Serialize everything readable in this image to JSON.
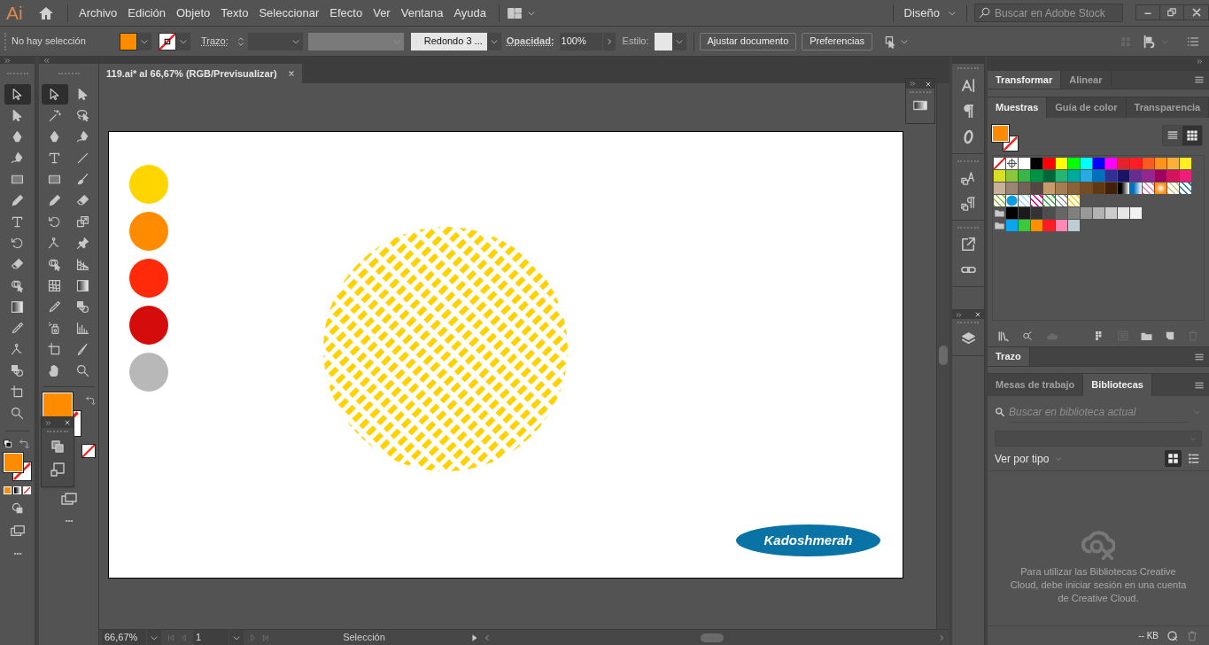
{
  "app": {
    "logo": "Ai"
  },
  "menu": [
    {
      "label": "Archivo"
    },
    {
      "label": "Edición"
    },
    {
      "label": "Objeto"
    },
    {
      "label": "Texto"
    },
    {
      "label": "Seleccionar"
    },
    {
      "label": "Efecto"
    },
    {
      "label": "Ver"
    },
    {
      "label": "Ventana"
    },
    {
      "label": "Ayuda"
    }
  ],
  "workspace": {
    "label": "Diseño"
  },
  "stock_search": {
    "placeholder": "Buscar en Adobe Stock"
  },
  "control_bar": {
    "selection": "No hay selección",
    "stroke_label": "Trazo:",
    "brush": "Redondo 3 ...",
    "opacity_label": "Opacidad:",
    "opacity": "100%",
    "style_label": "Estilo:",
    "buttons": [
      "Ajustar documento",
      "Preferencias"
    ]
  },
  "document_tab": {
    "title": "119.ai* al 66,67% (RGB/Previsualizar)"
  },
  "toolbar_left": [
    {
      "kind": "select",
      "selected": true
    },
    {
      "kind": "direct",
      "selected": false
    },
    {
      "kind": "pen",
      "selected": false
    },
    {
      "kind": "curve",
      "selected": false
    },
    {
      "kind": "rect",
      "selected": false
    },
    {
      "kind": "pencil",
      "selected": false
    },
    {
      "kind": "type",
      "selected": false
    },
    {
      "kind": "rotate",
      "selected": false
    },
    {
      "kind": "eraser",
      "selected": false
    },
    {
      "kind": "shapebuilder",
      "selected": false
    },
    {
      "kind": "gradient",
      "selected": false
    },
    {
      "kind": "eyedropper",
      "selected": false
    },
    {
      "kind": "warp",
      "selected": false
    },
    {
      "kind": "blend",
      "selected": false
    },
    {
      "kind": "artboard",
      "selected": false
    },
    {
      "kind": "zoom",
      "selected": false
    }
  ],
  "toolbar_right": [
    {
      "kind": "select",
      "selected": true
    },
    {
      "kind": "direct",
      "selected": false
    },
    {
      "kind": "wand",
      "selected": false
    },
    {
      "kind": "lasso",
      "selected": false
    },
    {
      "kind": "pen",
      "selected": false
    },
    {
      "kind": "curve",
      "selected": false
    },
    {
      "kind": "type",
      "selected": false
    },
    {
      "kind": "line",
      "selected": false
    },
    {
      "kind": "rect",
      "selected": false
    },
    {
      "kind": "brush",
      "selected": false
    },
    {
      "kind": "pencil",
      "selected": false
    },
    {
      "kind": "eraser",
      "selected": false
    },
    {
      "kind": "rotate",
      "selected": false
    },
    {
      "kind": "scale",
      "selected": false
    },
    {
      "kind": "warp",
      "selected": false
    },
    {
      "kind": "pin",
      "selected": false
    },
    {
      "kind": "shapebuilder",
      "selected": false
    },
    {
      "kind": "perspective",
      "selected": false
    },
    {
      "kind": "mesh",
      "selected": false
    },
    {
      "kind": "gradient",
      "selected": false
    },
    {
      "kind": "eyedropper",
      "selected": false
    },
    {
      "kind": "blend",
      "selected": false
    },
    {
      "kind": "sprayer",
      "selected": false
    },
    {
      "kind": "graph",
      "selected": false
    },
    {
      "kind": "artboard",
      "selected": false
    },
    {
      "kind": "slice",
      "selected": false
    },
    {
      "kind": "hand",
      "selected": false
    },
    {
      "kind": "zoom",
      "selected": false
    }
  ],
  "artboard": {
    "dots": [
      {
        "color": "#ffd500"
      },
      {
        "color": "#ff8c00"
      },
      {
        "color": "#ff2a0a"
      },
      {
        "color": "#d40c0c"
      },
      {
        "color": "#b8b8b8"
      }
    ],
    "logo": "Kadoshmerah"
  },
  "panels": {
    "transform_tabs": [
      {
        "label": "Transformar",
        "selected": true
      },
      {
        "label": "Alinear",
        "selected": false
      }
    ],
    "swatch_tabs": [
      {
        "label": "Muestras",
        "selected": true
      },
      {
        "label": "Guía de color",
        "selected": false
      },
      {
        "label": "Transparencia",
        "selected": false
      }
    ],
    "swatch_view": [
      {
        "kind": "list",
        "selected": false
      },
      {
        "kind": "grid",
        "selected": true
      }
    ],
    "swatches": [
      {
        "group": false,
        "items": [
          {
            "kind": "none"
          },
          {
            "kind": "registration"
          },
          {
            "kind": "color",
            "color": "#ffffff"
          },
          {
            "kind": "color",
            "color": "#000000"
          },
          {
            "kind": "color",
            "color": "#ff0000"
          },
          {
            "kind": "color",
            "color": "#ffff00"
          },
          {
            "kind": "color",
            "color": "#00ff00"
          },
          {
            "kind": "color",
            "color": "#00ffff"
          },
          {
            "kind": "color",
            "color": "#0000ff"
          },
          {
            "kind": "color",
            "color": "#ff00ff"
          },
          {
            "kind": "color",
            "color": "#e2232a"
          },
          {
            "kind": "color",
            "color": "#ff1d25"
          },
          {
            "kind": "color",
            "color": "#ff5a1f"
          },
          {
            "kind": "color",
            "color": "#ff931e"
          },
          {
            "kind": "color",
            "color": "#fbb03b"
          },
          {
            "kind": "color",
            "color": "#fcee21"
          }
        ]
      },
      {
        "group": false,
        "items": [
          {
            "kind": "color",
            "color": "#d9e021"
          },
          {
            "kind": "color",
            "color": "#8cc63f"
          },
          {
            "kind": "color",
            "color": "#39b54a"
          },
          {
            "kind": "color",
            "color": "#009245"
          },
          {
            "kind": "color",
            "color": "#006837"
          },
          {
            "kind": "color",
            "color": "#22b573"
          },
          {
            "kind": "color",
            "color": "#00a99d"
          },
          {
            "kind": "color",
            "color": "#29abe2"
          },
          {
            "kind": "color",
            "color": "#0071bc"
          },
          {
            "kind": "color",
            "color": "#2e3192"
          },
          {
            "kind": "color",
            "color": "#1b1464"
          },
          {
            "kind": "color",
            "color": "#662d91"
          },
          {
            "kind": "color",
            "color": "#93278f"
          },
          {
            "kind": "color",
            "color": "#9e005d"
          },
          {
            "kind": "color",
            "color": "#d4145a"
          },
          {
            "kind": "color",
            "color": "#ed1e79"
          }
        ]
      },
      {
        "group": false,
        "items": [
          {
            "kind": "color",
            "color": "#c7b299"
          },
          {
            "kind": "color",
            "color": "#998675"
          },
          {
            "kind": "color",
            "color": "#736357"
          },
          {
            "kind": "color",
            "color": "#534741"
          },
          {
            "kind": "color",
            "color": "#c69c6d"
          },
          {
            "kind": "color",
            "color": "#a67c52"
          },
          {
            "kind": "color",
            "color": "#8c6239"
          },
          {
            "kind": "color",
            "color": "#754c24"
          },
          {
            "kind": "color",
            "color": "#603813"
          },
          {
            "kind": "color",
            "color": "#42210b"
          },
          {
            "kind": "gradient",
            "color": "#000000"
          },
          {
            "kind": "gradient",
            "color": "#0071bc"
          },
          {
            "kind": "pattern",
            "color": "#ff7bac"
          },
          {
            "kind": "radial",
            "color": "#ff931e"
          },
          {
            "kind": "pattern",
            "color": "#d9c27a"
          },
          {
            "kind": "pattern",
            "color": "#1f7bb0"
          }
        ]
      },
      {
        "group": false,
        "items": [
          {
            "kind": "pattern",
            "color": "#8cc63f"
          },
          {
            "kind": "circle",
            "color": "#0a9ee0"
          },
          {
            "kind": "pattern",
            "color": "#9fdcf2"
          },
          {
            "kind": "pattern",
            "color": "#ec008c"
          },
          {
            "kind": "pattern",
            "color": "#39b54a"
          },
          {
            "kind": "pattern",
            "color": "#999999"
          },
          {
            "kind": "pattern",
            "color": "#ffd200"
          }
        ]
      },
      {
        "group": true,
        "items": [
          {
            "kind": "color",
            "color": "#000000"
          },
          {
            "kind": "color",
            "color": "#1a1a1a"
          },
          {
            "kind": "color",
            "color": "#333333"
          },
          {
            "kind": "color",
            "color": "#4d4d4d"
          },
          {
            "kind": "color",
            "color": "#666666"
          },
          {
            "kind": "color",
            "color": "#808080"
          },
          {
            "kind": "color",
            "color": "#999999"
          },
          {
            "kind": "color",
            "color": "#b3b3b3"
          },
          {
            "kind": "color",
            "color": "#cccccc"
          },
          {
            "kind": "color",
            "color": "#e6e6e6"
          },
          {
            "kind": "color",
            "color": "#f2f2f2"
          }
        ]
      },
      {
        "group": true,
        "items": [
          {
            "kind": "color",
            "color": "#0aa5f0"
          },
          {
            "kind": "color",
            "color": "#3cc83c"
          },
          {
            "kind": "color",
            "color": "#ff9100"
          },
          {
            "kind": "color",
            "color": "#ff1d25"
          },
          {
            "kind": "color",
            "color": "#ff88b4"
          },
          {
            "kind": "color",
            "color": "#bccdd4"
          }
        ]
      }
    ],
    "stroke_tabs": [
      {
        "label": "Trazo",
        "selected": true
      }
    ],
    "library_tabs": [
      {
        "label": "Mesas de trabajo",
        "selected": false
      },
      {
        "label": "Bibliotecas",
        "selected": true
      }
    ],
    "library_search": {
      "placeholder": "Buscar en biblioteca actual"
    },
    "library_view": {
      "label": "Ver por tipo"
    },
    "library_view_modes": [
      {
        "kind": "grid",
        "selected": true
      },
      {
        "kind": "list",
        "selected": false
      }
    ],
    "library_message": "Para utilizar las Bibliotecas Creative Cloud, debe iniciar sesión en una cuenta de Creative Cloud.",
    "library_size": "-- KB"
  },
  "status_bar": {
    "zoom": "66,67%",
    "artboard": "1",
    "tool": "Selección"
  }
}
